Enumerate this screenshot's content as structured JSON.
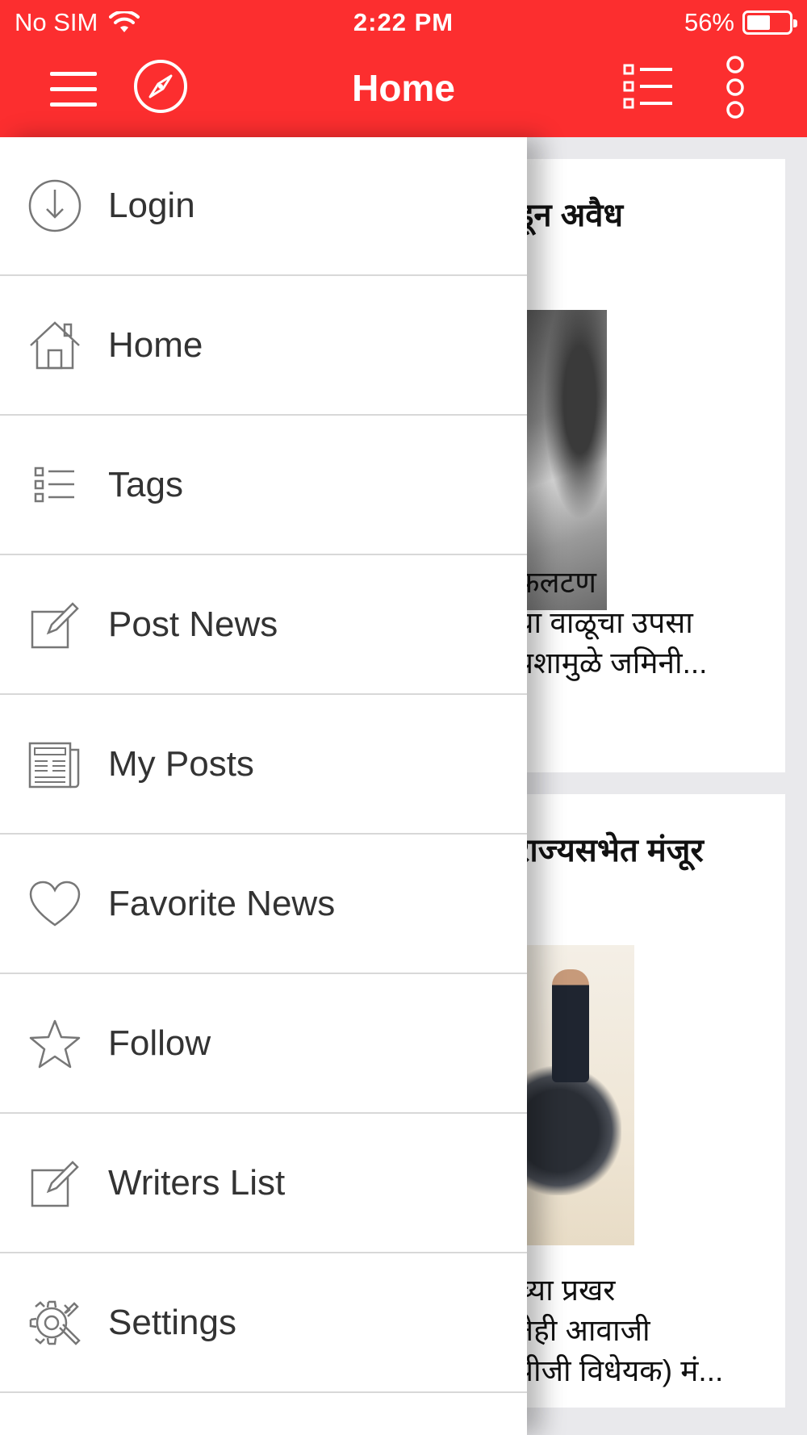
{
  "status_bar": {
    "carrier": "No SIM",
    "time": "2:22 PM",
    "battery_percent": "56%",
    "battery_level": 0.56,
    "wifi_icon": "wifi-icon"
  },
  "navbar": {
    "title": "Home",
    "left_icons": [
      "hamburger-menu-icon",
      "compass-icon"
    ],
    "right_icons": [
      "list-icon",
      "more-vertical-icon"
    ]
  },
  "colors": {
    "brand_red": "#fc2e2f",
    "drawer_bg": "#ffffff",
    "divider": "#d8d8d8",
    "text": "#333333",
    "icon_gray": "#777777"
  },
  "drawer": {
    "items": [
      {
        "label": "Login",
        "icon": "login-icon"
      },
      {
        "label": "Home",
        "icon": "home-icon"
      },
      {
        "label": "Tags",
        "icon": "tags-list-icon"
      },
      {
        "label": "Post News",
        "icon": "edit-icon"
      },
      {
        "label": "My Posts",
        "icon": "newspaper-icon"
      },
      {
        "label": "Favorite News",
        "icon": "heart-icon"
      },
      {
        "label": "Follow",
        "icon": "star-icon"
      },
      {
        "label": "Writers List",
        "icon": "edit-icon"
      },
      {
        "label": "Settings",
        "icon": "settings-icon"
      }
    ]
  },
  "feed": {
    "cards": [
      {
        "headline": "डून अवैध",
        "snippet_lines": [
          "फलटण",
          "या वाळूचा उपसा",
          "पशामुळे जमिनी..."
        ]
      },
      {
        "headline": "राज्यसभेत मंजूर",
        "snippet_lines": [
          "च्या प्रखर",
          "तेही आवाजी",
          "पीजी विधेयक) मं..."
        ]
      }
    ]
  }
}
